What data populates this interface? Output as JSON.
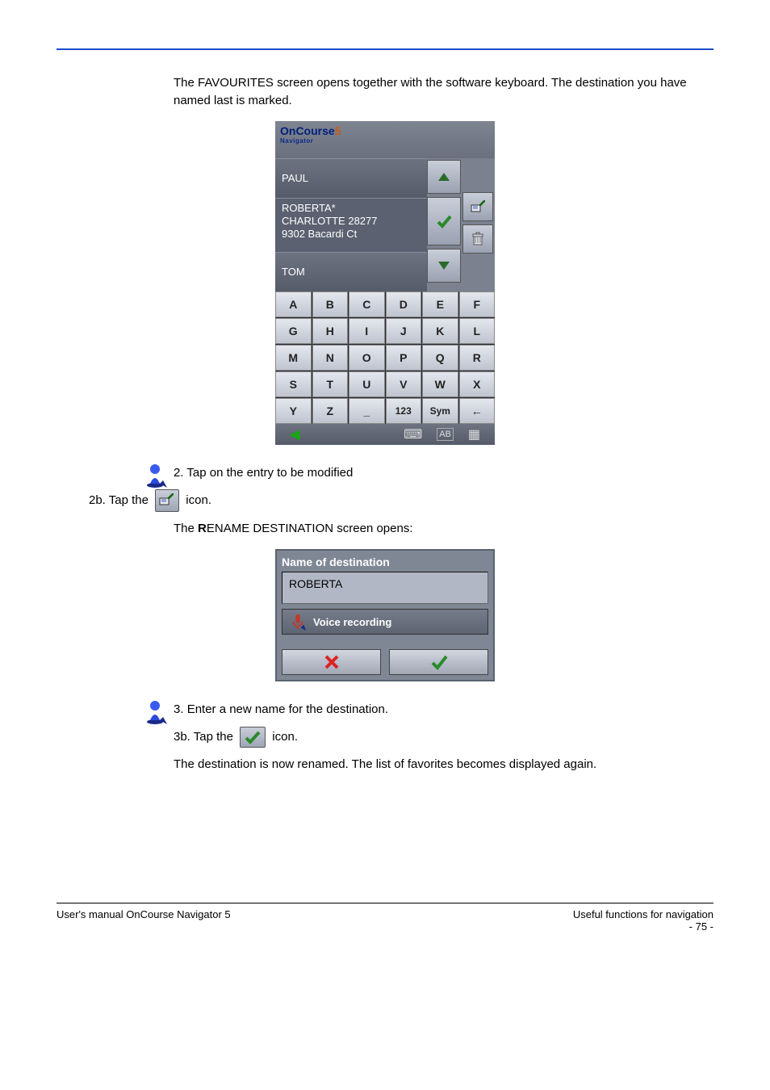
{
  "intro": "The FAVOURITES screen opens together with the software keyboard. The destination you have named last is marked.",
  "favourites": {
    "rows": [
      "PAUL",
      "TOM"
    ],
    "selected_row": {
      "line1": "ROBERTA*",
      "line2": "CHARLOTTE 28277",
      "line3": "9302 Bacardi Ct"
    },
    "keys": [
      "A",
      "B",
      "C",
      "D",
      "E",
      "F",
      "G",
      "H",
      "I",
      "J",
      "K",
      "L",
      "M",
      "N",
      "O",
      "P",
      "Q",
      "R",
      "S",
      "T",
      "U",
      "V",
      "W",
      "X",
      "Y",
      "Z",
      "_",
      "123",
      "Sym",
      "←"
    ]
  },
  "step2a": "Tap on the entry to be modified",
  "step2b_1": "Tap the ",
  "step2b_2": " icon.",
  "rename_screen_text": "The RENAME DESTINATION screen opens:",
  "dialog": {
    "caption": "Name of destination",
    "value": "ROBERTA",
    "voice_label": "Voice recording"
  },
  "step3a": "Enter a new name for the destination.",
  "step3b_1": "Tap the ",
  "step3b_2": " icon.",
  "final": "The destination is now renamed. The list of favorites becomes displayed again.",
  "footer": {
    "left": "User's manual OnCourse Navigator 5",
    "right_top": "Useful functions for navigation",
    "right_page": "- 75 -"
  }
}
